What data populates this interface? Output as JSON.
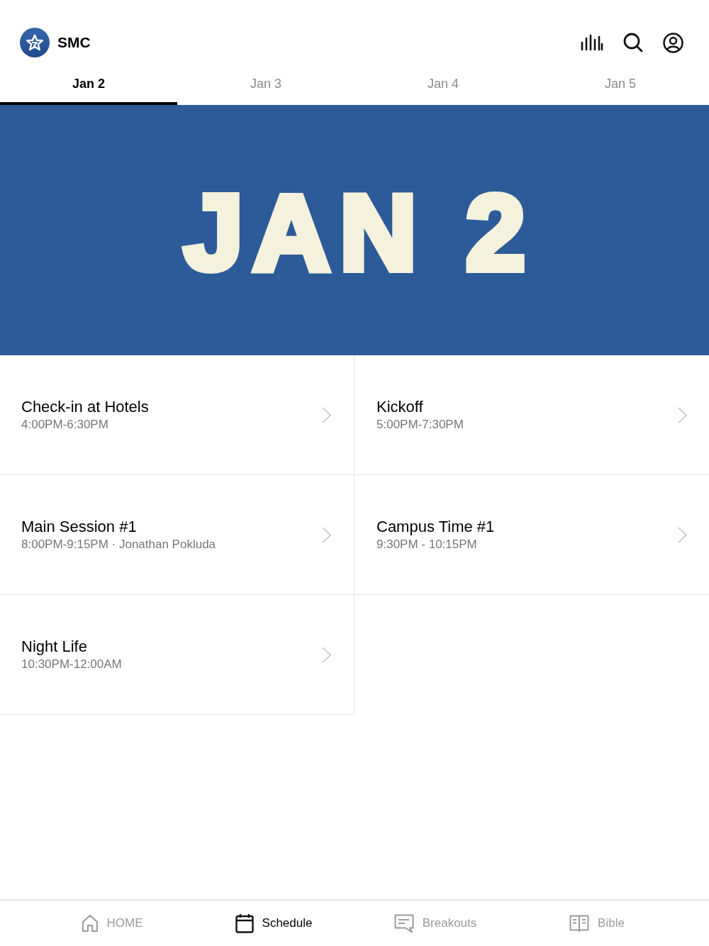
{
  "header": {
    "app_name": "SMC"
  },
  "tabs": [
    {
      "label": "Jan 2",
      "selected": true
    },
    {
      "label": "Jan 3",
      "selected": false
    },
    {
      "label": "Jan 4",
      "selected": false
    },
    {
      "label": "Jan 5",
      "selected": false
    }
  ],
  "banner": {
    "title": "JAN 2"
  },
  "sessions": [
    {
      "title": "Check-in at Hotels",
      "time": "4:00PM-6:30PM"
    },
    {
      "title": "Kickoff",
      "time": "5:00PM-7:30PM"
    },
    {
      "title": "Main Session #1",
      "time": "8:00PM-9:15PM · Jonathan Pokluda"
    },
    {
      "title": "Campus Time #1",
      "time": "9:30PM - 10:15PM"
    },
    {
      "title": "Night Life",
      "time": "10:30PM-12:00AM"
    }
  ],
  "bottom_nav": [
    {
      "label": "HOME",
      "selected": false
    },
    {
      "label": "Schedule",
      "selected": true
    },
    {
      "label": "Breakouts",
      "selected": false
    },
    {
      "label": "Bible",
      "selected": false
    }
  ]
}
